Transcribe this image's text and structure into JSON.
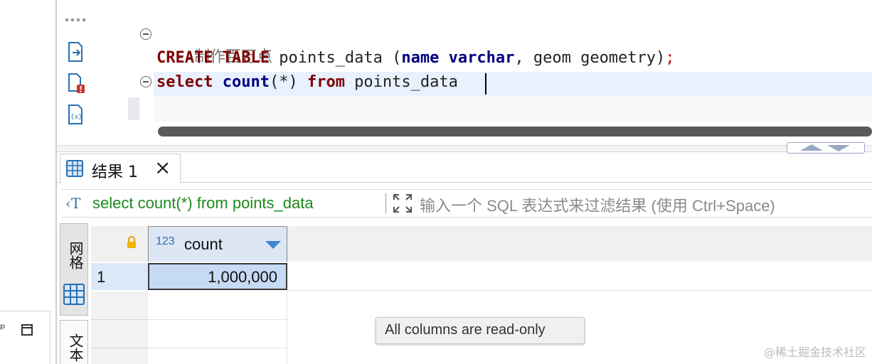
{
  "editor": {
    "comment_line": "--制作百万点",
    "line2": {
      "kw_create": "CREATE",
      "kw_table": "TABLE",
      "text1": " points_data (",
      "kw_name": "name",
      "kw_varchar": "varchar",
      "text2": ", geom geometry)",
      "semi": ";"
    },
    "line3": {
      "kw_select": "select",
      "kw_count": "count",
      "text1": "(*) ",
      "kw_from": "from",
      "text2": " points_data"
    }
  },
  "results_tab": {
    "label": "结果 1",
    "close_symbol": "×"
  },
  "filter_bar": {
    "sql_text": "select count(*) from points_data",
    "placeholder": "输入一个 SQL 表达式来过滤结果 (使用 Ctrl+Space)"
  },
  "grid": {
    "columns": [
      {
        "type_badge": "123",
        "name": "count"
      }
    ],
    "rows": [
      {
        "row_number": "1",
        "values": [
          "1,000,000"
        ]
      }
    ]
  },
  "side_tabs": {
    "grid_label": "网格",
    "text_label": "文本"
  },
  "tooltip": "All columns are read-only",
  "watermark": "@稀土掘金技术社区",
  "colors": {
    "keyword": "#7f0000",
    "keyword2": "#000080",
    "filter_sql": "#1c8a1c",
    "selected_cell": "#c6daf4",
    "header_selected": "#dde6f5"
  }
}
